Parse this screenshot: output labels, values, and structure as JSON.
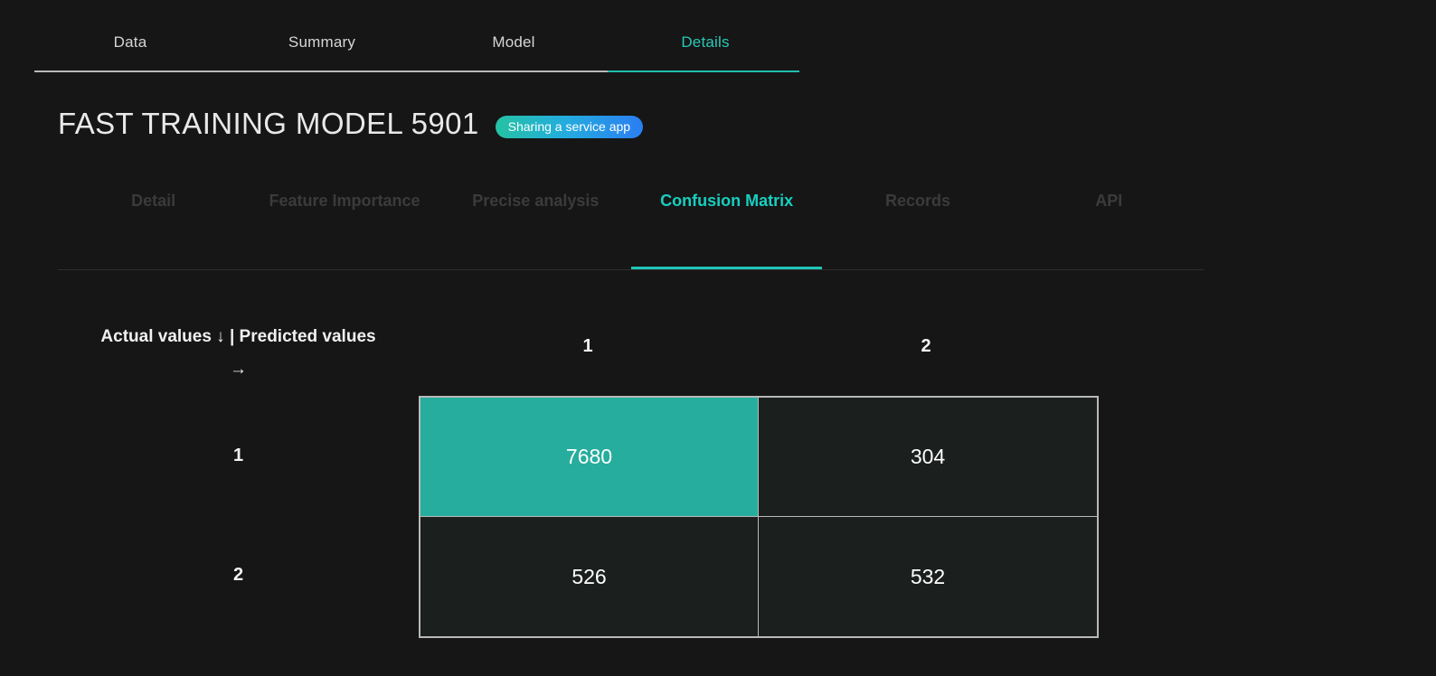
{
  "top_tabs": {
    "items": [
      {
        "label": "Data",
        "active": false
      },
      {
        "label": "Summary",
        "active": false
      },
      {
        "label": "Model",
        "active": false
      },
      {
        "label": "Details",
        "active": true
      }
    ]
  },
  "header": {
    "title": "FAST TRAINING MODEL 5901",
    "badge": "Sharing a service app"
  },
  "sub_tabs": {
    "items": [
      {
        "label": "Detail",
        "active": false
      },
      {
        "label": "Feature Importance",
        "active": false
      },
      {
        "label": "Precise analysis",
        "active": false
      },
      {
        "label": "Confusion Matrix",
        "active": true
      },
      {
        "label": "Records",
        "active": false
      },
      {
        "label": "API",
        "active": false
      }
    ]
  },
  "colors": {
    "background": "#161616",
    "accent_teal": "#17cfc0",
    "cell_highlight": "#27ad9d",
    "cell_base": "#1b1f1e",
    "grid_border": "#b9b9b9",
    "badge_start": "#25c2a4",
    "badge_end": "#2b7ef2",
    "inactive_subtab": "#3b3b3b"
  },
  "chart_data": {
    "type": "heatmap",
    "title": "Confusion Matrix",
    "corner_label": "Actual values ↓ | Predicted values →",
    "xlabel": "Predicted values",
    "ylabel": "Actual values",
    "categories": [
      "1",
      "2"
    ],
    "column_labels": [
      "1",
      "2"
    ],
    "row_labels": [
      "1",
      "2"
    ],
    "values": [
      [
        7680,
        304
      ],
      [
        526,
        532
      ]
    ],
    "cells": [
      {
        "actual": "1",
        "predicted": "1",
        "value": "7680",
        "highlight": true
      },
      {
        "actual": "1",
        "predicted": "2",
        "value": "304",
        "highlight": false
      },
      {
        "actual": "2",
        "predicted": "1",
        "value": "526",
        "highlight": false
      },
      {
        "actual": "2",
        "predicted": "2",
        "value": "532",
        "highlight": false
      }
    ],
    "grid": true,
    "legend": "none"
  }
}
